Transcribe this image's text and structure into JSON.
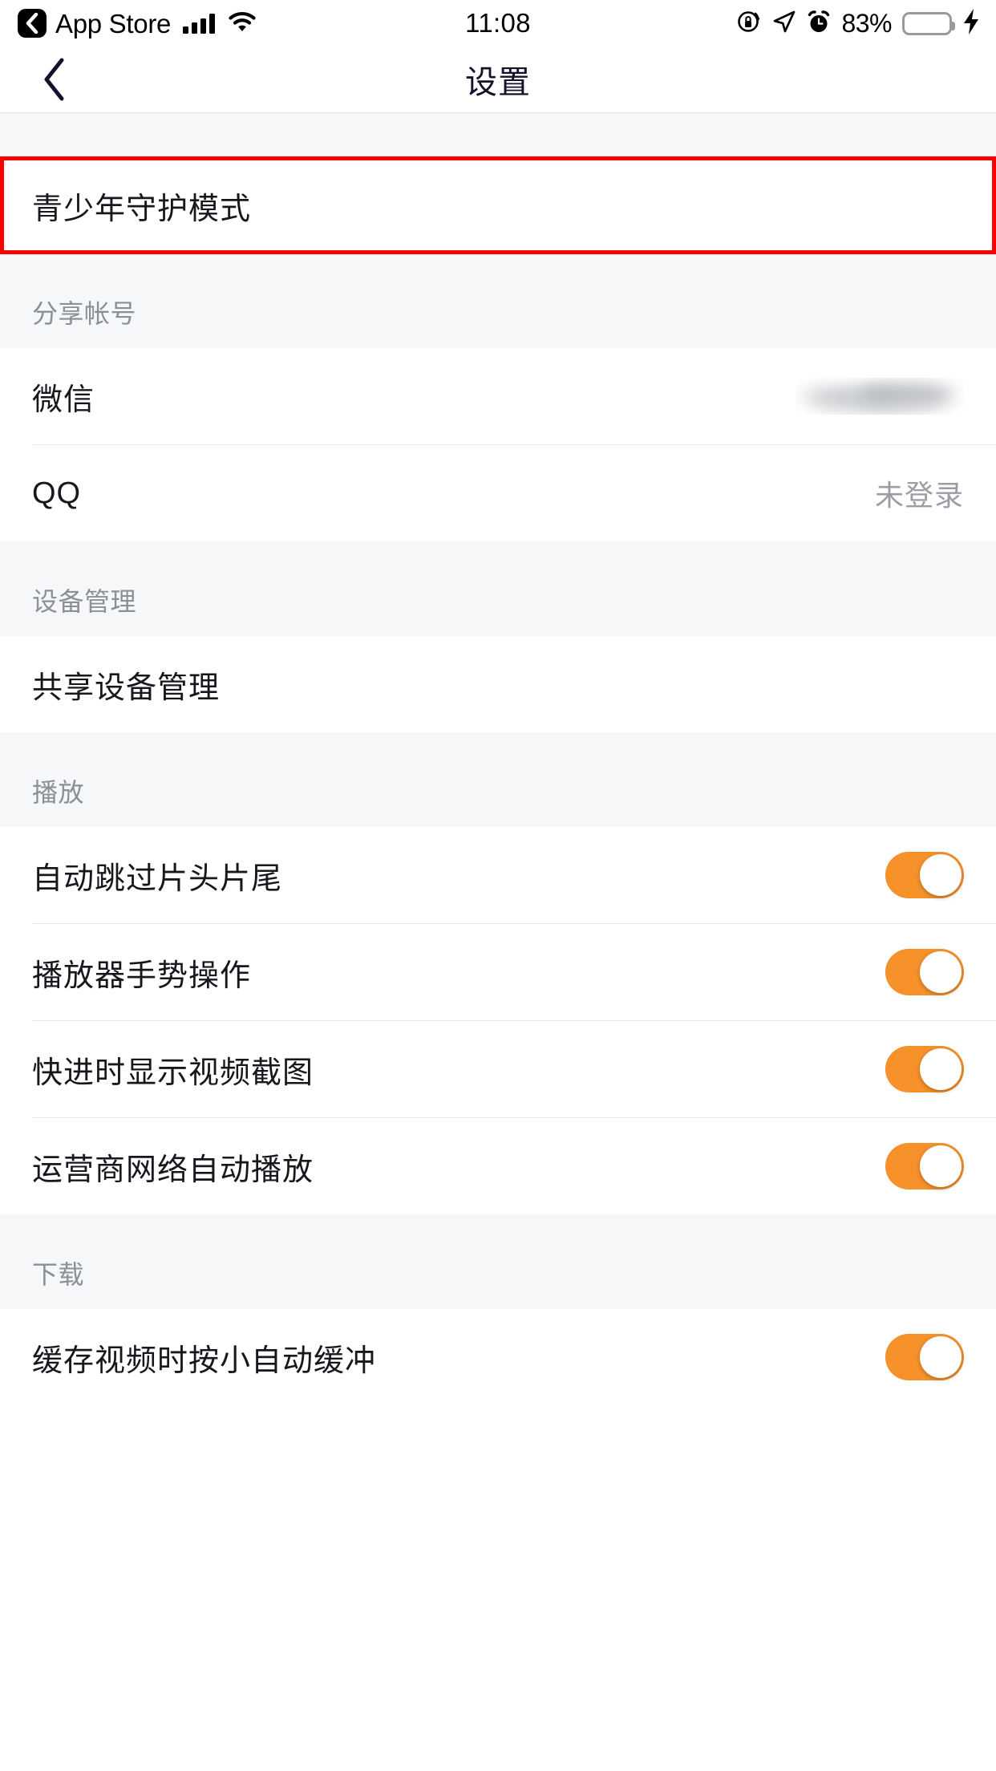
{
  "status_bar": {
    "back_app_label": "App Store",
    "back_chevron_icon": "chevron-left-icon",
    "signal_icon": "cellular-signal-icon",
    "wifi_icon": "wifi-icon",
    "time": "11:08",
    "rotation_lock_icon": "rotation-lock-icon",
    "location_icon": "location-arrow-icon",
    "alarm_icon": "alarm-clock-icon",
    "battery_percent": "83%",
    "battery_level": 83,
    "battery_color": "#4CD764",
    "charging_icon": "lightning-bolt-icon"
  },
  "nav_bar": {
    "back_icon": "chevron-left-icon",
    "title": "设置"
  },
  "highlight": {
    "color": "#ff0000",
    "target": "青少年守护模式"
  },
  "sections": [
    {
      "id": "teen-mode",
      "header": "",
      "rows": [
        {
          "id": "teen-guardian-mode",
          "label": "青少年守护模式",
          "type": "link",
          "value": ""
        }
      ]
    },
    {
      "id": "share-account",
      "header": "分享帐号",
      "rows": [
        {
          "id": "wechat",
          "label": "微信",
          "type": "blurred-value",
          "value": ""
        },
        {
          "id": "qq",
          "label": "QQ",
          "type": "value",
          "value": "未登录"
        }
      ]
    },
    {
      "id": "device-management",
      "header": "设备管理",
      "rows": [
        {
          "id": "shared-device-management",
          "label": "共享设备管理",
          "type": "link",
          "value": ""
        }
      ]
    },
    {
      "id": "playback",
      "header": "播放",
      "rows": [
        {
          "id": "auto-skip-intro-outro",
          "label": "自动跳过片头片尾",
          "type": "toggle",
          "toggle_on": true
        },
        {
          "id": "player-gesture-control",
          "label": "播放器手势操作",
          "type": "toggle",
          "toggle_on": true
        },
        {
          "id": "show-thumbnail-on-seek",
          "label": "快进时显示视频截图",
          "type": "toggle",
          "toggle_on": true
        },
        {
          "id": "carrier-network-autoplay",
          "label": "运营商网络自动播放",
          "type": "toggle",
          "toggle_on": true
        }
      ]
    },
    {
      "id": "download",
      "header": "下载",
      "rows": [
        {
          "id": "auto-next-on-download-complete",
          "label": "缓存视频时按小自动缓冲",
          "type": "toggle",
          "toggle_on": true
        }
      ]
    }
  ],
  "theme": {
    "accent": "#F7922B",
    "page_bg": "#f5f7f9",
    "row_bg": "#ffffff",
    "label_color": "#17171d",
    "muted_color": "#8c9096"
  }
}
